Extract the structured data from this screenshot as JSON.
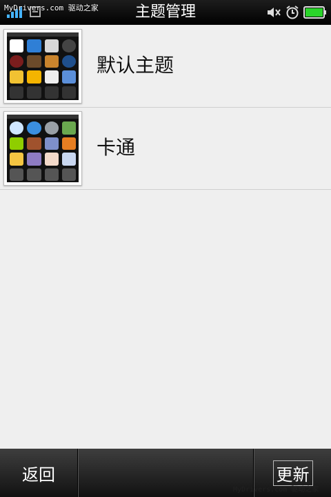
{
  "status_bar": {
    "watermark": "MyDrivers.com 驱动之家",
    "title": "主题管理",
    "icons": [
      "signal-icon",
      "network-icon",
      "mute-icon",
      "alarm-icon",
      "battery-icon"
    ],
    "battery_color": "#2ad42a"
  },
  "themes": [
    {
      "name": "默认主题"
    },
    {
      "name": "卡通"
    }
  ],
  "bottom_bar": {
    "back_label": "返回",
    "update_label": "更新"
  },
  "watermark_bottom": "MyDrivers.com 驱动之家"
}
